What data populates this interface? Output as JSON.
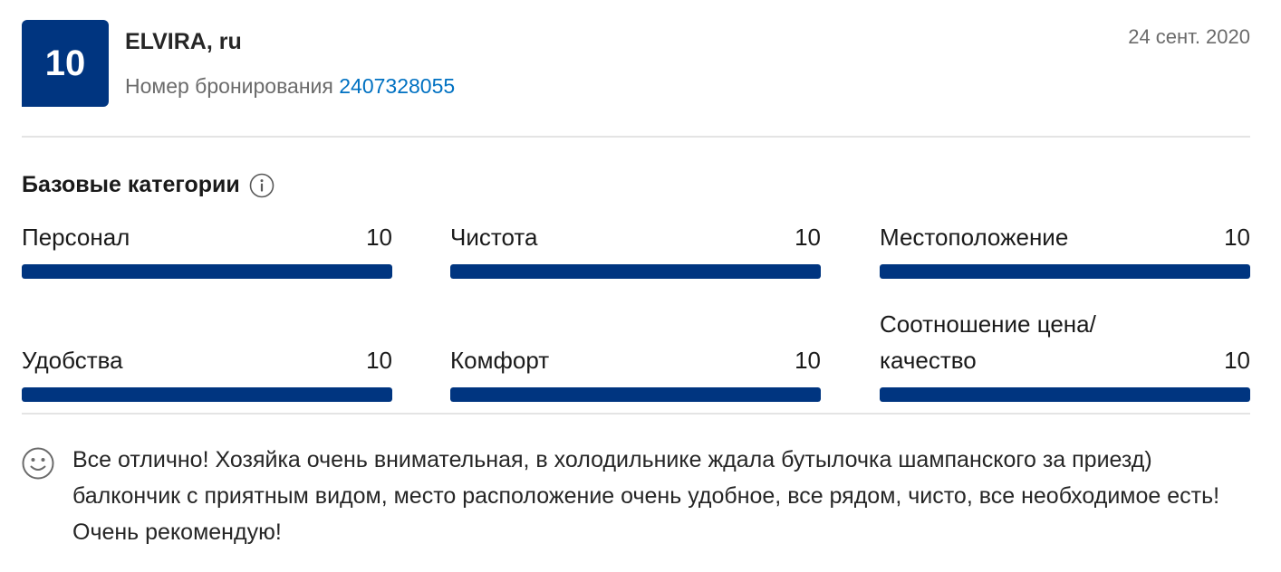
{
  "review": {
    "score": "10",
    "reviewer": "ELVIRA, ru",
    "booking_label": "Номер бронирования",
    "booking_number": "2407328055",
    "date": "24 сент. 2020"
  },
  "categories": {
    "heading": "Базовые категории",
    "info_icon": "info-icon",
    "items": [
      {
        "label": "Персонал",
        "value": "10",
        "fraction": 1.0
      },
      {
        "label": "Чистота",
        "value": "10",
        "fraction": 1.0
      },
      {
        "label": "Местоположение",
        "value": "10",
        "fraction": 1.0
      },
      {
        "label": "Удобства",
        "value": "10",
        "fraction": 1.0
      },
      {
        "label": "Комфорт",
        "value": "10",
        "fraction": 1.0
      },
      {
        "label": "Соотношение цена/\nкачество",
        "value": "10",
        "fraction": 1.0
      }
    ]
  },
  "comment": {
    "icon": "smile-icon",
    "text": "Все отлично! Хозяйка очень внимательная, в холодильнике ждала бутылочка шампанского за приезд) балкончик с приятным видом, место расположение очень удобное, все рядом, чисто, все необходимое есть! Очень рекомендую!"
  },
  "colors": {
    "brand": "#003580",
    "link": "#0071c2",
    "muted": "#6b6b6b"
  }
}
